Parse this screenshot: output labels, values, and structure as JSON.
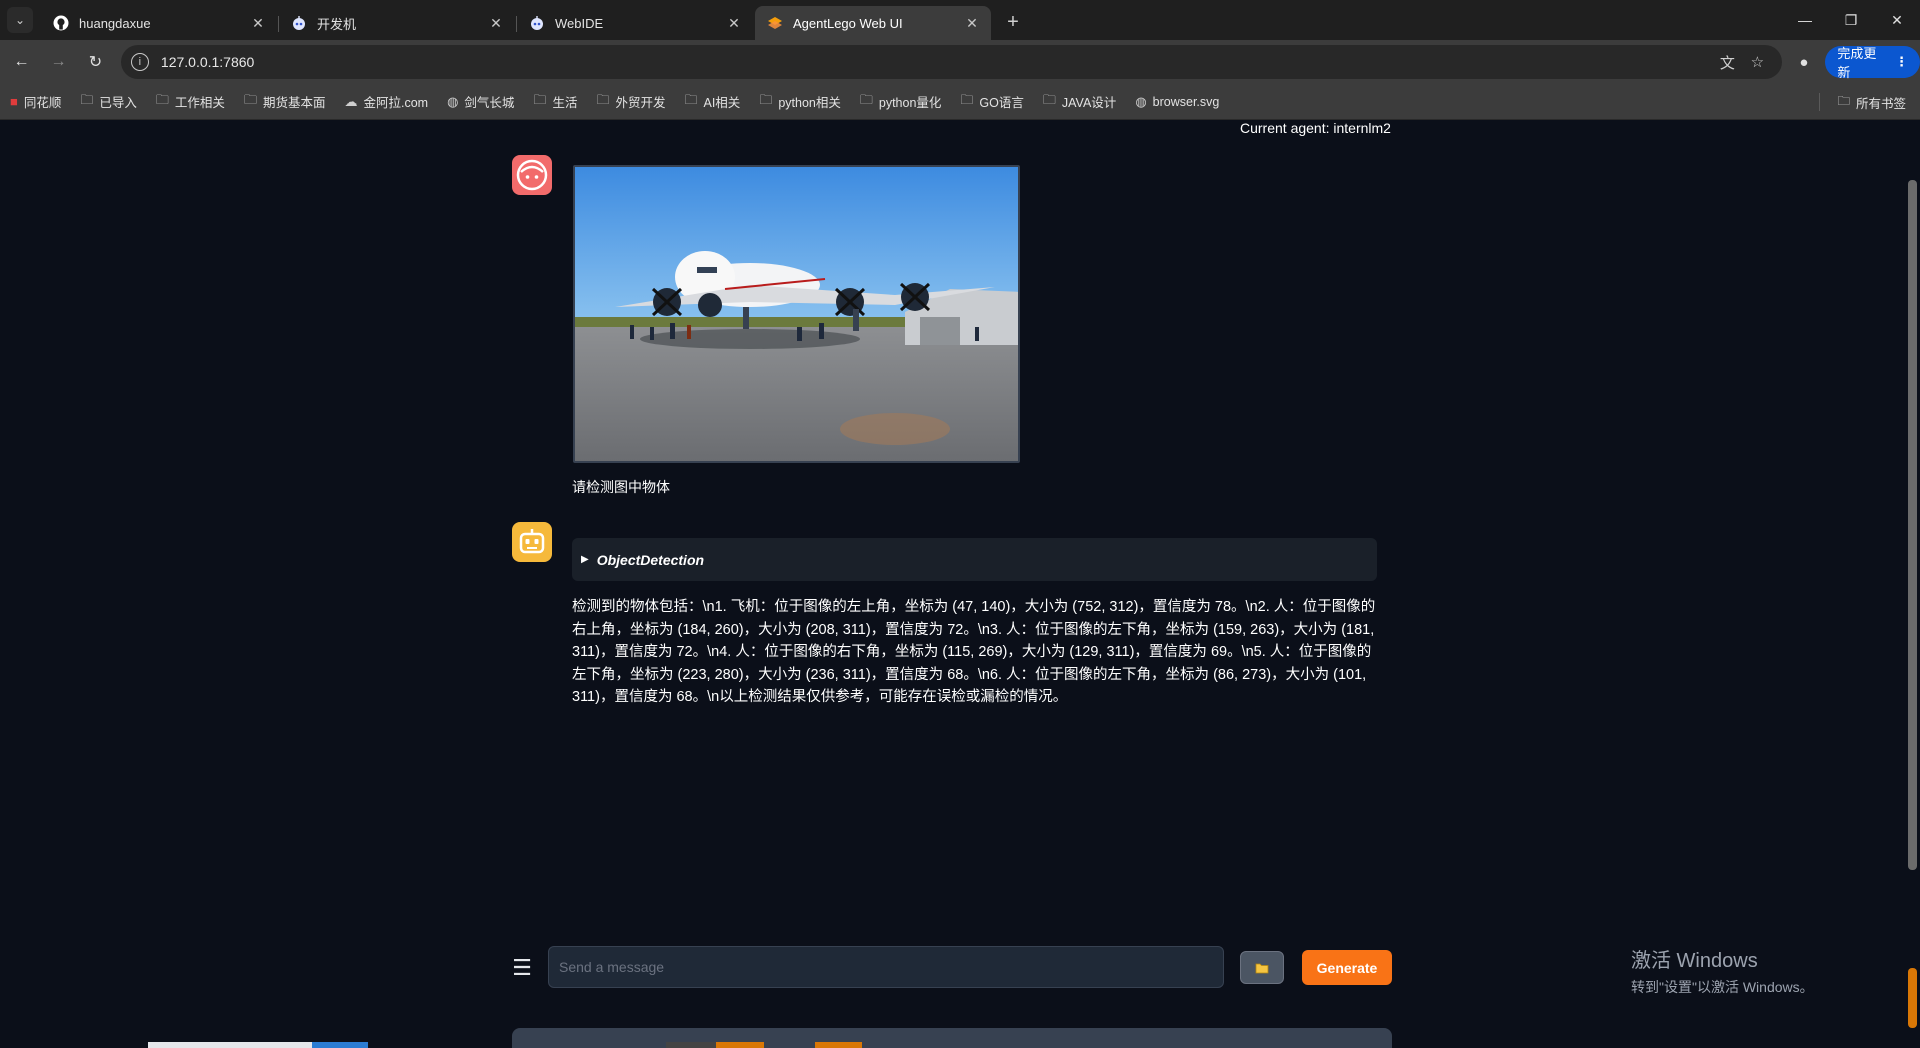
{
  "browser": {
    "tabs": [
      {
        "title": "huangdaxue",
        "icon": "github-icon",
        "active": false
      },
      {
        "title": "开发机",
        "icon": "robot-icon",
        "active": false
      },
      {
        "title": "WebIDE",
        "icon": "robot-icon",
        "active": false
      },
      {
        "title": "AgentLego Web UI",
        "icon": "gradio-icon",
        "active": true
      }
    ],
    "url": "127.0.0.1:7860",
    "update_label": "完成更新",
    "bookmarks": [
      {
        "label": "同花顺",
        "icon": "tonghuashun-icon"
      },
      {
        "label": "已导入",
        "icon": "folder-icon"
      },
      {
        "label": "工作相关",
        "icon": "folder-icon"
      },
      {
        "label": "期货基本面",
        "icon": "folder-icon"
      },
      {
        "label": "金阿拉.com",
        "icon": "cloud-icon"
      },
      {
        "label": "剑气长城",
        "icon": "globe-icon"
      },
      {
        "label": "生活",
        "icon": "folder-icon"
      },
      {
        "label": "外贸开发",
        "icon": "folder-icon"
      },
      {
        "label": "AI相关",
        "icon": "folder-icon"
      },
      {
        "label": "python相关",
        "icon": "folder-icon"
      },
      {
        "label": "python量化",
        "icon": "folder-icon"
      },
      {
        "label": "GO语言",
        "icon": "folder-icon"
      },
      {
        "label": "JAVA设计",
        "icon": "folder-icon"
      },
      {
        "label": "browser.svg",
        "icon": "globe-icon"
      }
    ],
    "all_bookmarks_label": "所有书签"
  },
  "app": {
    "current_agent": "Current agent: internlm2",
    "user_message": {
      "image_alt": "airplane-photo",
      "text": "请检测图中物体"
    },
    "bot_message": {
      "tool_name": "ObjectDetection",
      "result": "检测到的物体包括：\\n1. 飞机：位于图像的左上角，坐标为 (47, 140)，大小为 (752, 312)，置信度为 78。\\n2. 人：位于图像的右上角，坐标为 (184, 260)，大小为 (208, 311)，置信度为 72。\\n3. 人：位于图像的左下角，坐标为 (159, 263)，大小为 (181, 311)，置信度为 72。\\n4. 人：位于图像的右下角，坐标为 (115, 269)，大小为 (129, 311)，置信度为 69。\\n5. 人：位于图像的左下角，坐标为 (223, 280)，大小为 (236, 311)，置信度为 68。\\n6. 人：位于图像的左下角，坐标为 (86, 273)，大小为 (101, 311)，置信度为 68。\\n以上检测结果仅供参考，可能存在误检或漏检的情况。"
    },
    "input": {
      "placeholder": "Send a message",
      "value": ""
    },
    "generate_label": "Generate"
  },
  "watermark": {
    "line1": "激活 Windows",
    "line2": "转到\"设置\"以激活 Windows。"
  },
  "colors": {
    "accent": "#f97316",
    "background": "#0b0f19",
    "user_avatar": "#f26b6b",
    "bot_avatar": "#f6b93b"
  }
}
